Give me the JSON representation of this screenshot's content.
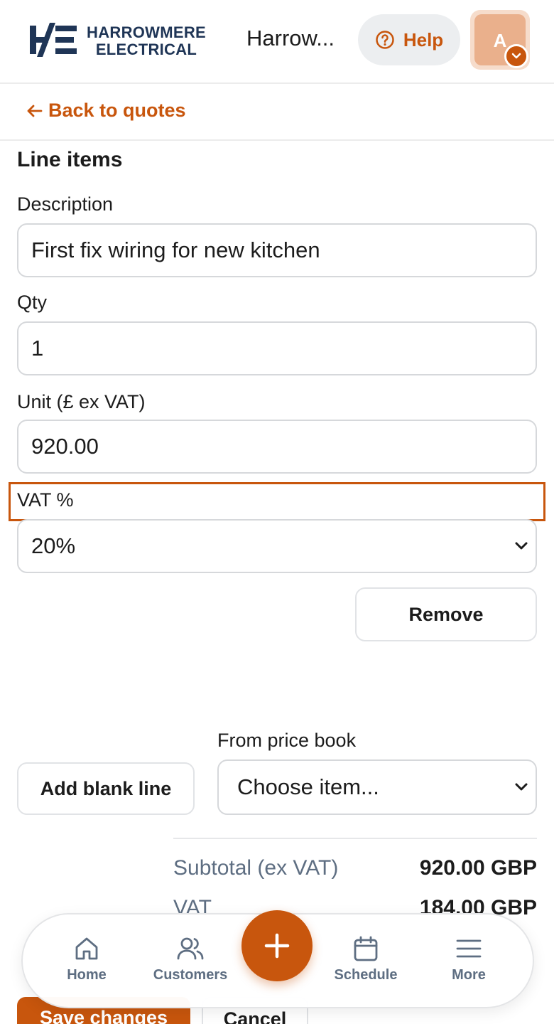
{
  "header": {
    "logo_line1": "HARROWMERE",
    "logo_line2": "ELECTRICAL",
    "org_name": "Harrow...",
    "help_label": "Help",
    "avatar_initial": "A"
  },
  "nav": {
    "back_label": "Back to quotes"
  },
  "line_items": {
    "title": "Line items",
    "description_label": "Description",
    "description_value": "First fix wiring for new kitchen",
    "qty_label": "Qty",
    "qty_value": "1",
    "unit_label": "Unit (£ ex VAT)",
    "unit_value": "920.00",
    "vat_label": "VAT %",
    "vat_value": "20%",
    "remove_label": "Remove"
  },
  "add": {
    "add_blank_label": "Add blank line",
    "price_book_label": "From price book",
    "price_book_value": "Choose item..."
  },
  "totals": {
    "subtotal_label": "Subtotal (ex VAT)",
    "subtotal_value": "920.00 GBP",
    "vat_label": "VAT",
    "vat_value": "184.00 GBP"
  },
  "actions": {
    "save_label": "Save changes",
    "cancel_label": "Cancel"
  },
  "bottom_nav": {
    "home": "Home",
    "customers": "Customers",
    "schedule": "Schedule",
    "more": "More"
  },
  "colors": {
    "accent": "#c8560d",
    "brand_navy": "#1f3556",
    "muted": "#5e6e82"
  }
}
